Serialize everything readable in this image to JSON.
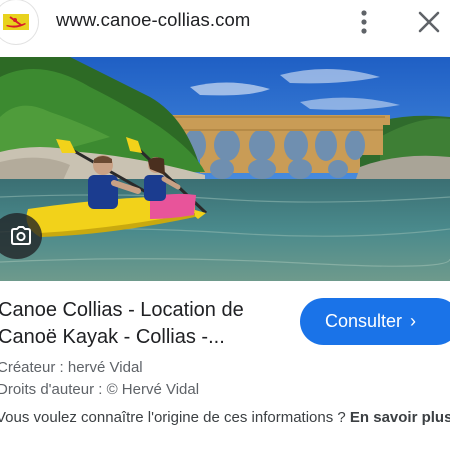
{
  "header": {
    "url": "www.canoe-collias.com",
    "more_icon": "more-vert-icon",
    "close_icon": "close-icon"
  },
  "result": {
    "title_line1": "Canoe Collias - Location de",
    "title_line2": "Canoë Kayak - Collias -...",
    "consult_label": "Consulter",
    "creator": "Créateur : hervé Vidal",
    "copyright": "Droits d'auteur : © Hervé Vidal",
    "info_text": "Vous voulez connaître l'origine de ces informations ? ",
    "learn_more": "En savoir plus"
  },
  "colors": {
    "accent": "#1a73e8",
    "kayak": "#f2d21a",
    "bridge": "#c99c56",
    "water": "#3f7e86"
  }
}
